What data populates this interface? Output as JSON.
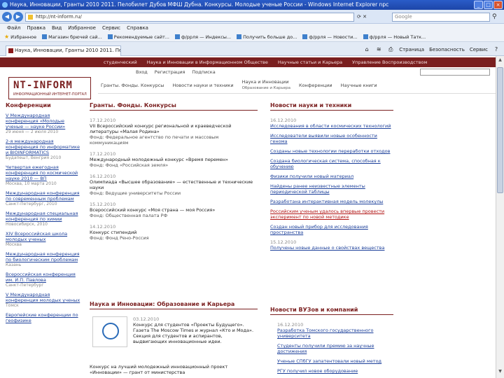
{
  "window": {
    "title": "Наука, Инновации, Гранты 2010 2011. Пелобилет Дубов МФШ Дубна. Конкурсы. Молодые ученые России - Windows Internet Explorer npc",
    "min": "_",
    "max": "□",
    "close": "×"
  },
  "address": {
    "url": "http://nt-inform.ru/",
    "go": "",
    "search_placeholder": "Google"
  },
  "menu": [
    "Файл",
    "Правка",
    "Вид",
    "Избранное",
    "Сервис",
    "Справка"
  ],
  "favorites": [
    "Избранное",
    "Магазин брючей сай...",
    "Рекомендуемые сайт...",
    "ф/ррля — Индексы...",
    "Получить больше до...",
    "ф/ррля — Новости...",
    "ф/ррля — Новый Татк..."
  ],
  "tab": {
    "label": "Наука, Инновации, Гранты 2010 2011. Пелобилет..."
  },
  "commands": [
    "Страница",
    "Безопасность",
    "Сервис"
  ],
  "topnav": [
    "студенческий",
    "Наука и Инновации в Информационном Обществе",
    "Научные статьи и Карьера",
    "Управление Воспроизводством"
  ],
  "login": [
    "Вход",
    "Регистрация",
    "Подписка"
  ],
  "logo": {
    "main": "NT-INFORM",
    "sub": "ИНФОРМАЦИОННЫЙ ИНТЕРНЕТ-ПОРТАЛ"
  },
  "catnav": [
    {
      "label": "Гранты. Фонды. Конкурсы"
    },
    {
      "label": "Новости науки и техники"
    },
    {
      "label": "Наука и Инновации",
      "sub": "Образование и Карьера"
    },
    {
      "label": "Конференции"
    },
    {
      "label": "Научные книги"
    }
  ],
  "left": {
    "heading": "Конференции",
    "items": [
      {
        "title": "V Международная конференция «Молодые ученые — науке России»",
        "date": "29 июня — 2 июля 2010"
      },
      {
        "title": "2-я международная конференция по информатике и BIOINFORMATICS",
        "date": "Будапешт, Венгрия 2010"
      },
      {
        "title": "Четвертая ежегодная конференция по космической науке 2010 — ВП",
        "date": "Москва, 10 марта 2010"
      },
      {
        "title": "Международная конференция по современным проблемам",
        "date": "Санкт-Петербург, 2010"
      },
      {
        "title": "Международная специальная конференция по химии",
        "date": "Новосибирск, 2010"
      },
      {
        "title": "XIV Всероссийская школа молодых ученых",
        "date": "Москва"
      },
      {
        "title": "Международная конференция по биологическим проблемам",
        "date": "Казань"
      },
      {
        "title": "Всероссийская конференция им. И.П. Павлова",
        "date": "Санкт-Петербург"
      },
      {
        "title": "V Международная конференция молодых ученых",
        "date": "Томск"
      },
      {
        "title": "Европейские конференции по геофизике",
        "date": ""
      }
    ]
  },
  "grants": {
    "heading": "Гранты. Фонды. Конкурсы",
    "items": [
      {
        "date": "17.12.2010",
        "title": "VII Всероссийский конкурс региональной и краеведческой литературы «Малая Родина»",
        "fund": "Фонд: Федеральное агентство по печати и массовым коммуникациям"
      },
      {
        "date": "17.12.2010",
        "title": "Международный молодежный конкурс «Время перемен»",
        "fund": "Фонд: Фонд «Российская земля»"
      },
      {
        "date": "16.12.2010",
        "title": "Олимпиада «Высшее образование» — естественные и технические науки",
        "fund": "Фонд: Ведущие университеты России"
      },
      {
        "date": "15.12.2010",
        "title": "Всероссийский конкурс «Моя страна — моя Россия»",
        "fund": "Фонд: Общественная палата РФ"
      },
      {
        "date": "14.12.2010",
        "title": "Конкурс стипендий",
        "fund": "Фонд: Фонд Рено-Россия"
      }
    ]
  },
  "news": {
    "heading": "Новости науки и техники",
    "items": [
      {
        "date": "16.12.2010",
        "title": "Исследования в области космических технологий"
      },
      {
        "date": "",
        "title": "Исследователи выявили новые особенности генома"
      },
      {
        "date": "",
        "title": "Созданы новые технологии переработки отходов"
      },
      {
        "date": "",
        "title": "Создана биологическая система, способная к обучению"
      },
      {
        "date": "",
        "title": "Физики получили новый материал"
      },
      {
        "date": "",
        "title": "Найдены ранее неизвестные элементы периодической таблицы"
      },
      {
        "date": "",
        "title": "Разработана интерактивная модель молекулы"
      },
      {
        "date": "",
        "title": "Российским ученым удалось впервые провести эксперимент по новой методике",
        "red": true
      },
      {
        "date": "",
        "title": "Создан новый прибор для исследования пространства"
      },
      {
        "date": "15.12.2010",
        "title": "Получены новые данные о свойствах вещества"
      }
    ]
  },
  "edu": {
    "heading": "Наука и Инновации: Образование и Карьера",
    "date": "03.12.2010",
    "text": "Конкурс для студентов «Проекты Будущего». Газета The Moscow Times и журнал «Кто и Мода». Секция для студентов и аспирантов, выдвигающих инновационные идеи.",
    "more": "Конкурс на лучший молодежный инновационный проект «Инновации» — грант от министерства"
  },
  "vuz": {
    "heading": "Новости ВУЗов и компаний",
    "items": [
      {
        "date": "16.12.2010",
        "title": "Разработка Томского государственного университета"
      },
      {
        "date": "",
        "title": "Студенты получили премию за научные достижения"
      },
      {
        "date": "",
        "title": "Ученые СПбГУ запатентовали новый метод"
      },
      {
        "date": "",
        "title": "РГУ получил новое оборудование"
      }
    ]
  }
}
